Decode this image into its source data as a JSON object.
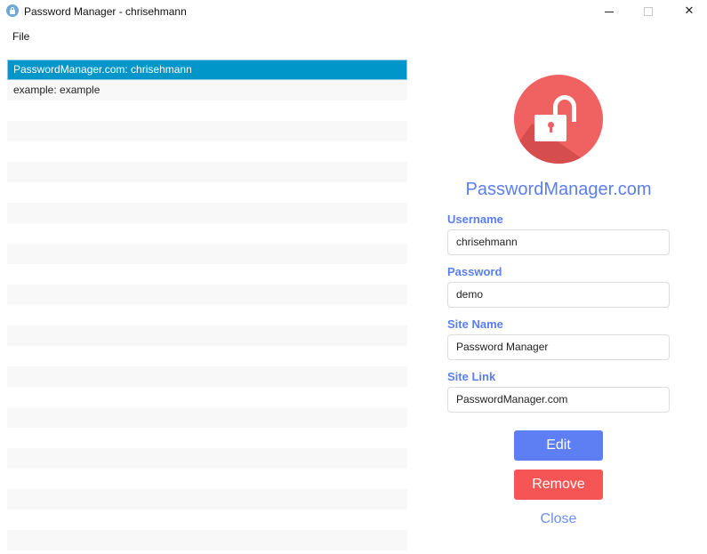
{
  "window": {
    "title": "Password Manager - chrisehmann",
    "minimize_glyph": "",
    "maximize_glyph": "",
    "close_glyph": "✕"
  },
  "menu": {
    "file_label": "File"
  },
  "entries": [
    {
      "label": "PasswordManager.com: chrisehmann",
      "selected": true
    },
    {
      "label": "example: example",
      "selected": false
    }
  ],
  "detail": {
    "icon": "unlocked-padlock-icon",
    "site_title": "PasswordManager.com",
    "username_label": "Username",
    "username_value": "chrisehmann",
    "password_label": "Password",
    "password_value": "demo",
    "site_name_label": "Site Name",
    "site_name_value": "Password Manager",
    "site_link_label": "Site Link",
    "site_link_value": "PasswordManager.com",
    "edit_label": "Edit",
    "remove_label": "Remove",
    "close_label": "Close"
  },
  "colors": {
    "accent": "#5b7ef0",
    "selection": "#0096c9",
    "remove": "#f55555",
    "lock_circle": "#f06262"
  }
}
